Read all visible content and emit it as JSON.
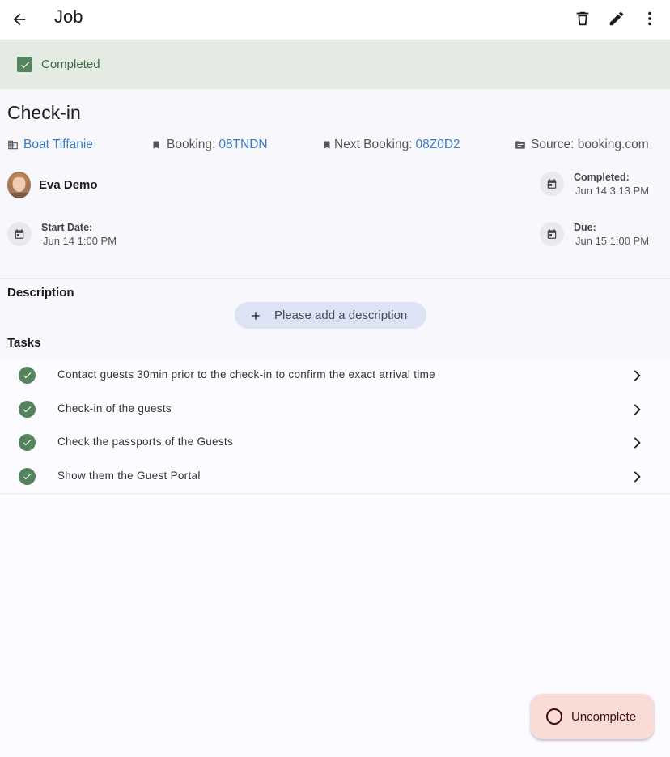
{
  "appbar": {
    "title": "Job",
    "icons": {
      "back": "arrow-left-icon",
      "delete": "trash-icon",
      "edit": "pencil-icon",
      "more": "more-vert-icon"
    }
  },
  "status": {
    "label": "Completed",
    "icon": "checkbox-checked-icon",
    "color": "#54835e"
  },
  "job": {
    "title": "Check-in",
    "property": {
      "value": "Boat Tiffanie",
      "icon": "building-icon"
    },
    "booking": {
      "label": "Booking: ",
      "value": "08TNDN",
      "icon": "bookmark-icon"
    },
    "next_booking": {
      "label": "Next Booking: ",
      "value": "08Z0D2",
      "icon": "bookmark-icon"
    },
    "source": {
      "label": "Source: booking.com",
      "icon": "source-icon"
    }
  },
  "assignee": {
    "name": "Eva Demo",
    "icon": "avatar"
  },
  "dates": {
    "completed": {
      "label": "Completed:",
      "value": "Jun 14 3:13 PM"
    },
    "start": {
      "label": "Start Date:",
      "value": "Jun 14 1:00 PM"
    },
    "due": {
      "label": "Due:",
      "value": "Jun 15 1:00 PM"
    }
  },
  "description": {
    "title": "Description",
    "add_label": "Please add a description"
  },
  "tasks": {
    "title": "Tasks",
    "items": [
      {
        "label": "Contact guests 30min prior to the check-in to confirm the exact arrival time"
      },
      {
        "label": "Check-in of the guests"
      },
      {
        "label": "Check the passports of the Guests"
      },
      {
        "label": "Show them the Guest Portal"
      }
    ]
  },
  "fab": {
    "label": "Uncomplete",
    "icon": "circle-outline-icon"
  },
  "colors": {
    "link": "#3a7cc4",
    "success": "#54835e",
    "banner": "#e3ebe2",
    "fab": "#f9dcd6"
  }
}
